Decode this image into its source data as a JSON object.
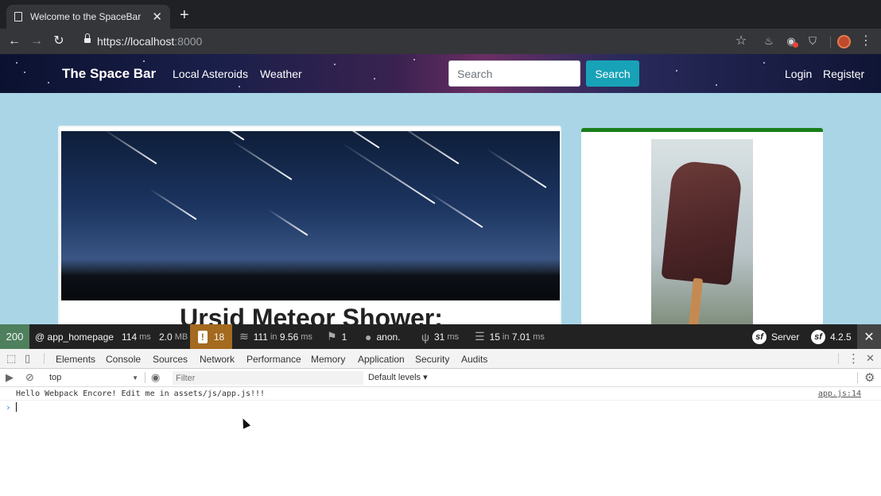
{
  "browser": {
    "tab_title": "Welcome to the SpaceBar",
    "url_main": "https://localhost",
    "url_port": ":8000"
  },
  "site": {
    "brand": "The Space Bar",
    "nav": [
      "Local Asteroids",
      "Weather"
    ],
    "search_placeholder": "Search",
    "search_button": "Search",
    "login": "Login",
    "register": "Register"
  },
  "article": {
    "title": "Ursid Meteor Shower:"
  },
  "symfony_toolbar": {
    "status": "200",
    "route": "@ app_homepage",
    "time_value": "114",
    "time_unit": "ms",
    "memory_value": "2.0",
    "memory_unit": "MB",
    "warnings": "18",
    "db_queries": "111",
    "db_in": "in",
    "db_time": "9.56",
    "db_unit": "ms",
    "translations": "1",
    "user": "anon.",
    "twig_time": "31",
    "twig_unit": "ms",
    "cache_calls": "15",
    "cache_in": "in",
    "cache_time": "7.01",
    "cache_unit": "ms",
    "server": "Server",
    "version": "4.2.5"
  },
  "devtools": {
    "tabs": [
      "Elements",
      "Console",
      "Sources",
      "Network",
      "Performance",
      "Memory",
      "Application",
      "Security",
      "Audits"
    ],
    "active_tab": "Console",
    "context": "top",
    "filter_placeholder": "Filter",
    "levels": "Default levels ▾",
    "log_message": "Hello Webpack Encore! Edit me in assets/js/app.js!!!",
    "log_source": "app.js:14"
  },
  "colors": {
    "info_button": "#17a2b8",
    "page_bg": "#a9d5e6",
    "status_ok": "#4f805d",
    "warning": "#a46a1f",
    "side_card_accent": "#1a7f1a"
  }
}
